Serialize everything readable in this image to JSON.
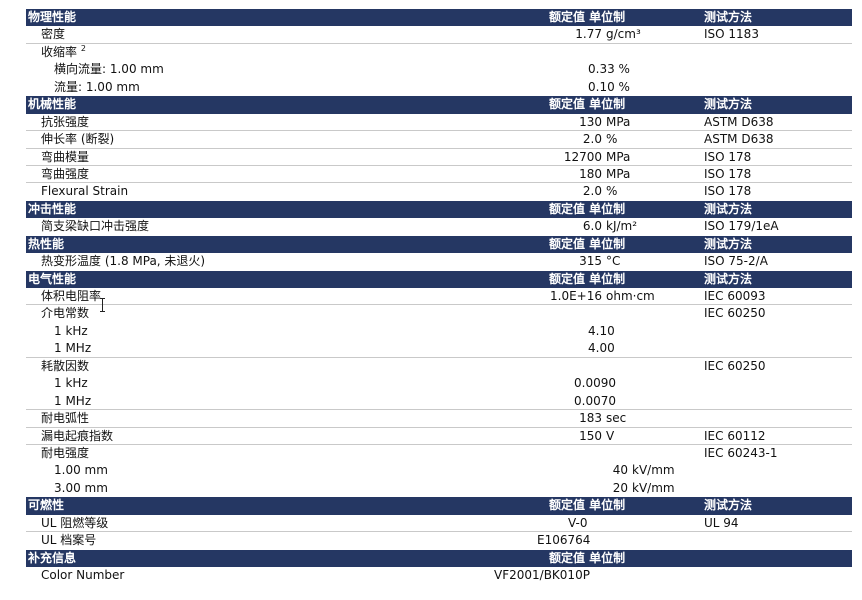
{
  "headers": {
    "physical": "物理性能",
    "mechanical": "机械性能",
    "impact": "冲击性能",
    "thermal": "热性能",
    "electrical": "电气性能",
    "flammability": "可燃性",
    "additional": "补充信息",
    "rated_value_unit": "额定值 单位制",
    "test_method": "测试方法"
  },
  "physical": {
    "density": {
      "label": "密度",
      "value": "1.77",
      "unit": "g/cm³",
      "method": "ISO 1183"
    },
    "shrinkage": {
      "label": "收缩率",
      "sup": "2"
    },
    "shrink_cross": {
      "label": "横向流量: 1.00 mm",
      "value": "0.33 %"
    },
    "shrink_flow": {
      "label": "流量: 1.00 mm",
      "value": "0.10 %"
    }
  },
  "mechanical": {
    "tensile": {
      "label": "抗张强度",
      "value": "130",
      "unit": "MPa",
      "method": "ASTM D638"
    },
    "elongation": {
      "label": "伸长率 (断裂)",
      "value": "2.0",
      "unit": "%",
      "method": "ASTM D638"
    },
    "flex_mod": {
      "label": "弯曲模量",
      "value": "12700",
      "unit": "MPa",
      "method": "ISO 178"
    },
    "flex_str": {
      "label": "弯曲强度",
      "value": "180",
      "unit": "MPa",
      "method": "ISO 178"
    },
    "flex_strain": {
      "label": "Flexural Strain",
      "value": "2.0",
      "unit": "%",
      "method": "ISO 178"
    }
  },
  "impact": {
    "charpy": {
      "label": "简支梁缺口冲击强度",
      "value": "6.0",
      "unit": "kJ/m²",
      "method": "ISO 179/1eA"
    }
  },
  "thermal": {
    "hdt": {
      "label": "热变形温度 (1.8 MPa, 未退火)",
      "value": "315",
      "unit": "°C",
      "method": "ISO 75-2/A"
    }
  },
  "electrical": {
    "vol_res": {
      "label": "体积电阻率",
      "value": "1.0E+16",
      "unit": "ohm·cm",
      "method": "IEC 60093"
    },
    "dielectric": {
      "label": "介电常数",
      "method": "IEC 60250"
    },
    "die_1k": {
      "label": "1 kHz",
      "value": "4.10"
    },
    "die_1m": {
      "label": "1 MHz",
      "value": "4.00"
    },
    "dissipation": {
      "label": "耗散因数",
      "method": "IEC 60250"
    },
    "dis_1k": {
      "label": "1 kHz",
      "value": "0.0090"
    },
    "dis_1m": {
      "label": "1 MHz",
      "value": "0.0070"
    },
    "arc": {
      "label": "耐电弧性",
      "value": "183",
      "unit": "sec"
    },
    "cti": {
      "label": "漏电起痕指数",
      "value": "150",
      "unit": "V",
      "method": "IEC 60112"
    },
    "strength": {
      "label": "耐电强度",
      "method": "IEC 60243-1"
    },
    "str_1": {
      "label": "1.00 mm",
      "value": "40",
      "unit": "kV/mm"
    },
    "str_3": {
      "label": "3.00 mm",
      "value": "20",
      "unit": "kV/mm"
    }
  },
  "flammability": {
    "ul_rating": {
      "label": "UL 阻燃等级",
      "value": "V-0",
      "method": "UL 94"
    },
    "ul_file": {
      "label": "UL 档案号",
      "value": "E106764"
    }
  },
  "additional": {
    "color": {
      "label": "Color Number",
      "value": "VF2001/BK010P"
    }
  }
}
